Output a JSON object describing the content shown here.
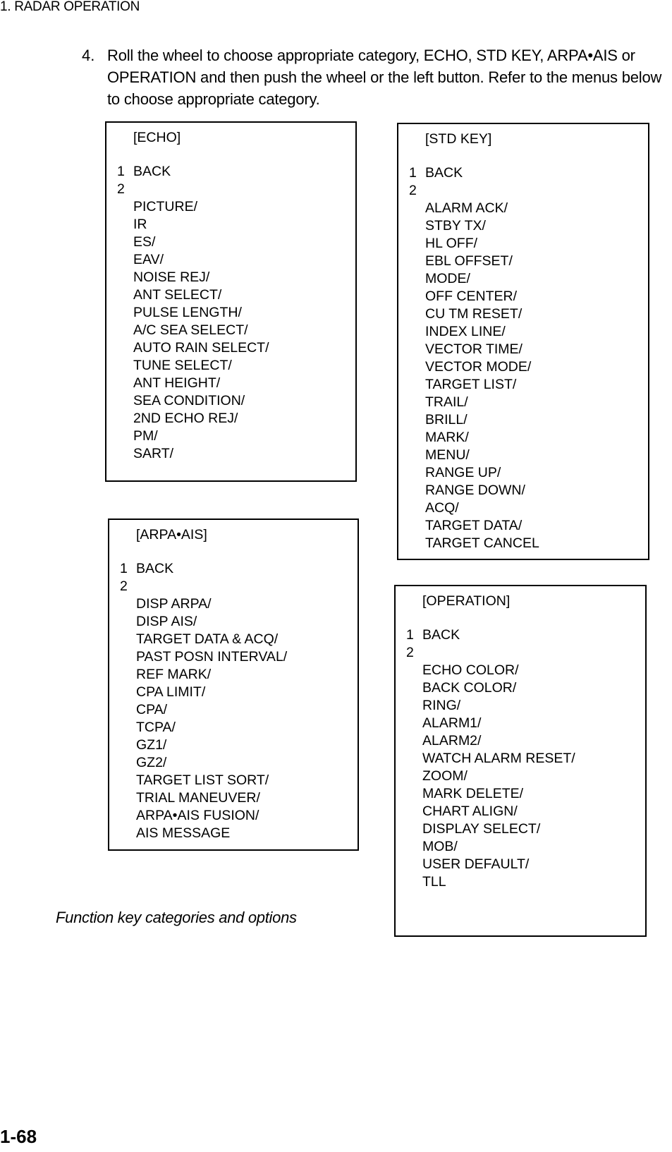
{
  "header": {
    "chapter": "1. RADAR OPERATION"
  },
  "step": {
    "number": "4.",
    "text": "Roll the wheel to choose appropriate category, ECHO, STD KEY, ARPA•AIS or OPERATION and then push the wheel or the left button. Refer to the menus below to choose appropriate category."
  },
  "menus": {
    "echo": {
      "title": "[ECHO]",
      "numbers": [
        "1",
        "2"
      ],
      "items": [
        "BACK",
        "",
        "PICTURE/",
        "IR",
        "ES/",
        "EAV/",
        "NOISE REJ/",
        "ANT SELECT/",
        "PULSE LENGTH/",
        "A/C SEA SELECT/",
        "AUTO RAIN SELECT/",
        "TUNE SELECT/",
        "ANT HEIGHT/",
        "SEA CONDITION/",
        "2ND ECHO REJ/",
        "PM/",
        "SART/"
      ]
    },
    "std_key": {
      "title": "[STD KEY]",
      "numbers": [
        "1",
        "2"
      ],
      "items": [
        "BACK",
        "",
        "ALARM ACK/",
        "STBY TX/",
        "HL OFF/",
        "EBL OFFSET/",
        "MODE/",
        "OFF CENTER/",
        "CU TM RESET/",
        "INDEX LINE/",
        "VECTOR TIME/",
        "VECTOR MODE/",
        "TARGET LIST/",
        "TRAIL/",
        "BRILL/",
        "MARK/",
        "MENU/",
        "RANGE UP/",
        "RANGE DOWN/",
        "ACQ/",
        "TARGET DATA/",
        "TARGET CANCEL"
      ]
    },
    "arpa_ais": {
      "title": "[ARPA•AIS]",
      "numbers": [
        "1",
        "2"
      ],
      "items": [
        "BACK",
        "",
        "DISP ARPA/",
        "DISP AIS/",
        "TARGET DATA & ACQ/",
        "PAST POSN INTERVAL/",
        "REF MARK/",
        "CPA LIMIT/",
        "CPA/",
        "TCPA/",
        "GZ1/",
        "GZ2/",
        "TARGET LIST SORT/",
        "TRIAL MANEUVER/",
        "ARPA•AIS FUSION/",
        "AIS MESSAGE"
      ]
    },
    "operation": {
      "title": "[OPERATION]",
      "numbers": [
        "1",
        "2"
      ],
      "items": [
        "BACK",
        "",
        "ECHO COLOR/",
        "BACK COLOR/",
        "RING/",
        "ALARM1/",
        "ALARM2/",
        "WATCH ALARM RESET/",
        "ZOOM/",
        "MARK DELETE/",
        "CHART ALIGN/",
        "DISPLAY SELECT/",
        "MOB/",
        "USER DEFAULT/",
        "TLL"
      ]
    }
  },
  "caption": "Function key categories and options",
  "page_number": "1-68"
}
